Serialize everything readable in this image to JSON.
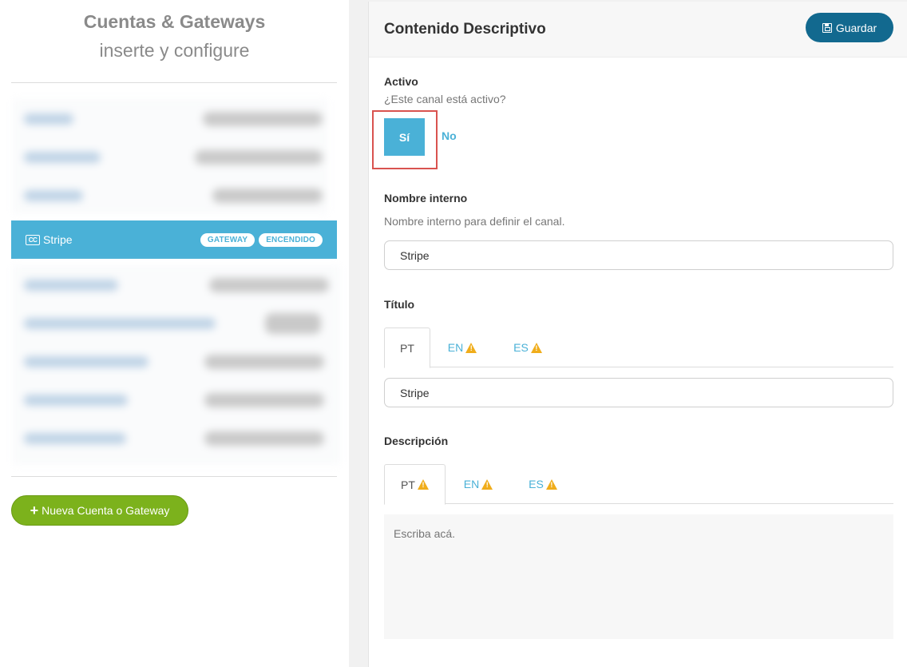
{
  "left_panel": {
    "title": "Cuentas & Gateways",
    "subtitle": "inserte y configure",
    "selected_account": {
      "icon": "credit-card-icon",
      "icon_text": "CC",
      "name": "Stripe",
      "badges": [
        "GATEWAY",
        "ENCENDIDO"
      ]
    },
    "new_button_label": "Nueva Cuenta o Gateway"
  },
  "right_panel": {
    "title": "Contenido Descriptivo",
    "save_label": "Guardar",
    "active": {
      "label": "Activo",
      "help": "¿Este canal está activo?",
      "yes_label": "Sí",
      "no_label": "No",
      "selected": "yes"
    },
    "internal_name": {
      "label": "Nombre interno",
      "help": "Nombre interno para definir el canal.",
      "value": "Stripe"
    },
    "title_field": {
      "label": "Título",
      "tabs": [
        {
          "label": "PT",
          "warning": false,
          "active": true
        },
        {
          "label": "EN",
          "warning": true,
          "active": false
        },
        {
          "label": "ES",
          "warning": true,
          "active": false
        }
      ],
      "value": "Stripe"
    },
    "description": {
      "label": "Descripción",
      "tabs": [
        {
          "label": "PT",
          "warning": true,
          "active": true
        },
        {
          "label": "EN",
          "warning": true,
          "active": false
        },
        {
          "label": "ES",
          "warning": true,
          "active": false
        }
      ],
      "placeholder": "Escriba acá."
    }
  },
  "colors": {
    "accent": "#4ab1d7",
    "save_button": "#12698f",
    "new_button": "#7cb21c",
    "warning": "#f0ad1b",
    "highlight": "#d9534f"
  }
}
